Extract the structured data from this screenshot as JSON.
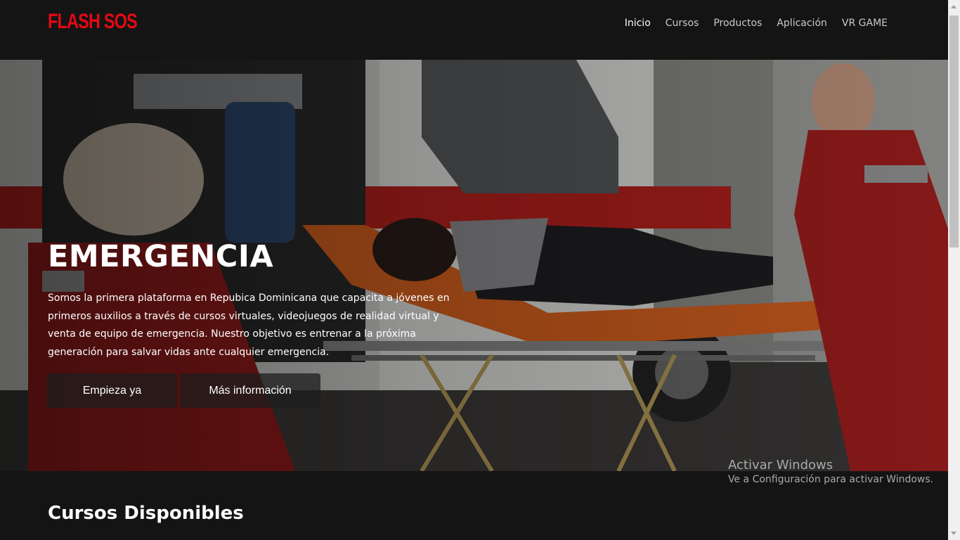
{
  "header": {
    "logo": "FLASH SOS",
    "nav": [
      {
        "label": "Inicio",
        "active": true
      },
      {
        "label": "Cursos",
        "active": false
      },
      {
        "label": "Productos",
        "active": false
      },
      {
        "label": "Aplicación",
        "active": false
      },
      {
        "label": "VR GAME",
        "active": false
      }
    ]
  },
  "hero": {
    "title": "EMERGENCIA",
    "description": "Somos la primera plataforma en Repubica Dominicana que capacita a jóvenes en primeros auxilios a través de cursos virtuales, videojuegos de realidad virtual y venta de equipo de emergencia. Nuestro objetivo es entrenar a la próxima generación para salvar vidas ante cualquier emergencia.",
    "buttons": {
      "start": "Empieza ya",
      "info": "Más información"
    }
  },
  "sections": {
    "courses_title": "Cursos Disponibles"
  },
  "watermark": {
    "title": "Activar Windows",
    "subtitle": "Ve a Configuración para activar Windows."
  },
  "colors": {
    "brand": "#e50914",
    "background": "#141414",
    "text": "#ffffff"
  }
}
